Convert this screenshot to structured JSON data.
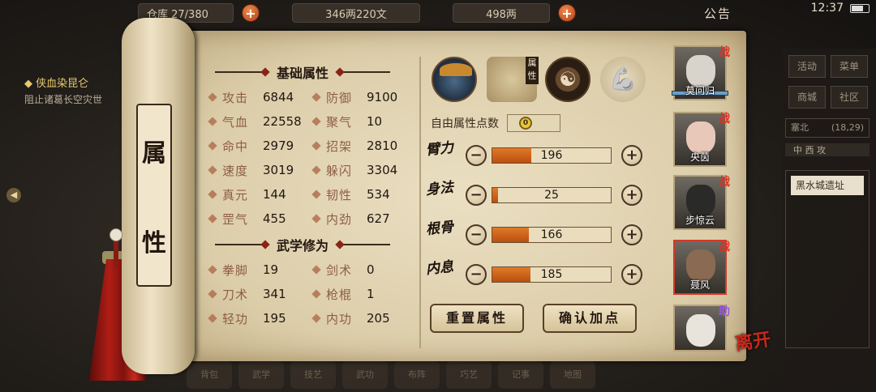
{
  "top_bar": {
    "storage": "仓库 27/380",
    "silver": "346两220文",
    "gold": "498两",
    "announcement": "公告",
    "time": "12:37"
  },
  "quest": {
    "title": "◆ 侠血染昆仑",
    "desc": "阻止诸葛长空灾世"
  },
  "right_menu": {
    "buttons": [
      "活动",
      "菜单",
      "商城",
      "社区"
    ],
    "location": "塞北",
    "coords": "(18,29)",
    "tabs": "中  西  攻",
    "place": "黑水城遗址"
  },
  "bottom_bar": [
    "背包",
    "武学",
    "技艺",
    "武功",
    "布阵",
    "巧艺",
    "记事",
    "地图"
  ],
  "scroll_title": [
    "属",
    "性"
  ],
  "basic": {
    "title": "基础属性",
    "stats": [
      {
        "label": "攻击",
        "value": "6844"
      },
      {
        "label": "防御",
        "value": "9100"
      },
      {
        "label": "气血",
        "value": "22558"
      },
      {
        "label": "聚气",
        "value": "10"
      },
      {
        "label": "命中",
        "value": "2979"
      },
      {
        "label": "招架",
        "value": "2810"
      },
      {
        "label": "速度",
        "value": "3019"
      },
      {
        "label": "躲闪",
        "value": "3304"
      },
      {
        "label": "真元",
        "value": "144"
      },
      {
        "label": "韧性",
        "value": "534"
      },
      {
        "label": "罡气",
        "value": "455"
      },
      {
        "label": "内劲",
        "value": "627"
      }
    ]
  },
  "martial": {
    "title": "武学修为",
    "stats": [
      {
        "label": "拳脚",
        "value": "19"
      },
      {
        "label": "剑术",
        "value": "0"
      },
      {
        "label": "刀术",
        "value": "341"
      },
      {
        "label": "枪棍",
        "value": "1"
      },
      {
        "label": "轻功",
        "value": "195"
      },
      {
        "label": "内功",
        "value": "205"
      }
    ]
  },
  "tabs": {
    "attr_tag": "属性"
  },
  "free_points": {
    "label": "自由属性点数",
    "value": "0"
  },
  "attributes": [
    {
      "name": "臂力",
      "value": "196",
      "fill": 0.33
    },
    {
      "name": "身法",
      "value": "25",
      "fill": 0.05
    },
    {
      "name": "根骨",
      "value": "166",
      "fill": 0.31
    },
    {
      "name": "内息",
      "value": "185",
      "fill": 0.32
    }
  ],
  "buttons": {
    "reset": "重置属性",
    "confirm": "确认加点"
  },
  "characters": [
    {
      "name": "莫问归",
      "tag": "战"
    },
    {
      "name": "央茵",
      "tag": "战"
    },
    {
      "name": "步惊云",
      "tag": "战"
    },
    {
      "name": "聂风",
      "tag": "战"
    },
    {
      "name": "",
      "tag": "助"
    }
  ],
  "leave": "离开",
  "colors": {
    "accent_orange": "#e07a28",
    "tag_red": "#e03020",
    "parchment": "#dccda9"
  }
}
